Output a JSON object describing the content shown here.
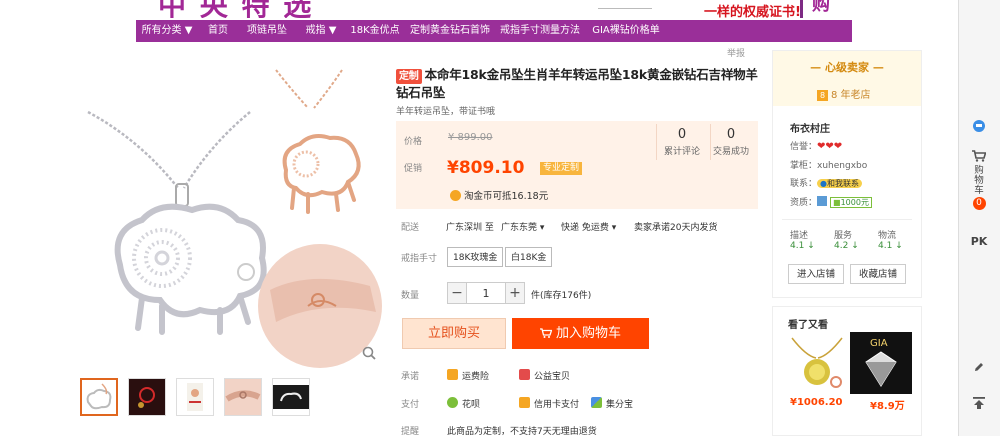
{
  "banner": {
    "cert_text": "一样的权威证书!"
  },
  "nav": {
    "items": [
      {
        "label": "所有分类 ▼",
        "w": 62
      },
      {
        "label": "首页",
        "w": 40
      },
      {
        "label": "项链吊坠",
        "w": 58
      },
      {
        "label": "戒指 ▼",
        "w": 50
      },
      {
        "label": "18K金优点",
        "w": 58
      },
      {
        "label": "定制黄金钻石首饰",
        "w": 92
      },
      {
        "label": "戒指手寸测量方法",
        "w": 88
      },
      {
        "label": "GIA裸钻价格单",
        "w": 84
      }
    ]
  },
  "report": "举报",
  "product": {
    "badge": "定制",
    "title": "本命年18k金吊坠生肖羊年转运吊坠18k黄金嵌钻石吉祥物羊钻石吊坠",
    "subtitle": "羊年转运吊坠，带证书哦",
    "price_label": "价格",
    "original_price": "¥ 899.00",
    "promo_label": "促销",
    "promo_price": "¥809.10",
    "promo_badge": "专业定制",
    "reviews_count": "0",
    "reviews_label": "累计评论",
    "sales_count": "0",
    "sales_label": "交易成功",
    "coin_text": "淘金币可抵16.18元",
    "delivery_label": "配送",
    "delivery_from": "广东深圳 至",
    "delivery_to": "广东东莞",
    "delivery_service": "快递 免运费",
    "delivery_promise": "卖家承诺20天内发货",
    "ring_size_label": "戒指手寸",
    "ring_size_options": [
      "18K玫瑰金",
      "白18K金"
    ],
    "quantity_label": "数量",
    "quantity_value": "1",
    "stock_text": "件(库存176件)",
    "buy_now": "立即购买",
    "add_to_cart": "加入购物车",
    "promise_label": "承诺",
    "promise_items": [
      "运费险",
      "公益宝贝"
    ],
    "payment_label": "支付",
    "payment_items": [
      "花呗",
      "信用卡支付",
      "集分宝"
    ],
    "notice_label": "提醒",
    "notice_text": "此商品为定制，不支持7天无理由退货"
  },
  "thumbnails": [
    "thumb-1",
    "thumb-2",
    "thumb-3",
    "thumb-4",
    "thumb-5"
  ],
  "shop": {
    "level": "心级卖家",
    "years_icon": "8",
    "years": "8 年老店",
    "name": "布衣村庄",
    "credit_label": "信誉：",
    "owner_label": "掌柜：",
    "owner": "xuhengxbo",
    "contact_label": "联系：",
    "contact_badge": "和我联系",
    "qualification_label": "资质：",
    "deposit": "1000元",
    "ratings": [
      {
        "label": "描述",
        "value": "4.1",
        "arrow": "↓"
      },
      {
        "label": "服务",
        "value": "4.2",
        "arrow": "↓"
      },
      {
        "label": "物流",
        "value": "4.1",
        "arrow": "↓"
      }
    ],
    "enter_shop": "进入店铺",
    "favorite_shop": "收藏店铺"
  },
  "see_also": {
    "title": "看了又看",
    "items": [
      {
        "price": "¥1006.20"
      },
      {
        "price": "¥8.9万"
      }
    ]
  },
  "toolbar": {
    "cart_label": "购物车",
    "cart_count": "0",
    "pk_label": "PK"
  },
  "colors": {
    "nav_purple": "#9a2f99",
    "price_orange": "#ff4400",
    "price_box_bg": "#fff2e8",
    "buy_now_bg": "#ffe4d0"
  }
}
